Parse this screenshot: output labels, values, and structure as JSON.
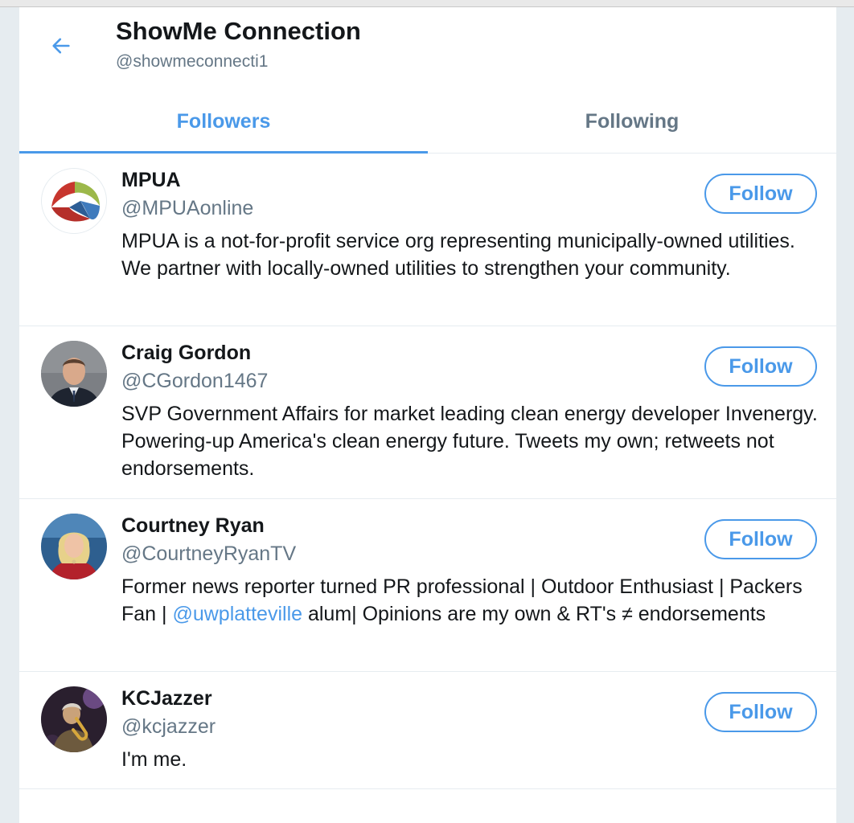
{
  "header": {
    "title": "ShowMe Connection",
    "handle": "@showmeconnecti1",
    "back_icon": "arrow-left-icon"
  },
  "tabs": [
    {
      "label": "Followers",
      "active": true
    },
    {
      "label": "Following",
      "active": false
    }
  ],
  "colors": {
    "accent": "#4a99e9",
    "text": "#14171a",
    "secondary_text": "#657786"
  },
  "users": [
    {
      "name": "MPUA",
      "handle": "@MPUAonline",
      "bio": "MPUA is a not-for-profit service org representing municipally-owned utilities. We partner with locally-owned utilities to strengthen your community.",
      "follow_label": "Follow"
    },
    {
      "name": "Craig Gordon",
      "handle": "@CGordon1467",
      "bio": "SVP Government Affairs for market leading clean energy developer Invenergy. Powering-up America's clean energy future. Tweets my own; retweets not endorsements.",
      "follow_label": "Follow"
    },
    {
      "name": "Courtney Ryan",
      "handle": "@CourtneyRyanTV",
      "bio_before": "Former news reporter turned PR professional | Outdoor Enthusiast | Packers Fan | ",
      "bio_mention": "@uwplatteville",
      "bio_after": " alum| Opinions are my own & RT's ≠ endorsements",
      "follow_label": "Follow"
    },
    {
      "name": "KCJazzer",
      "handle": "@kcjazzer",
      "bio": "I'm me.",
      "follow_label": "Follow"
    }
  ]
}
